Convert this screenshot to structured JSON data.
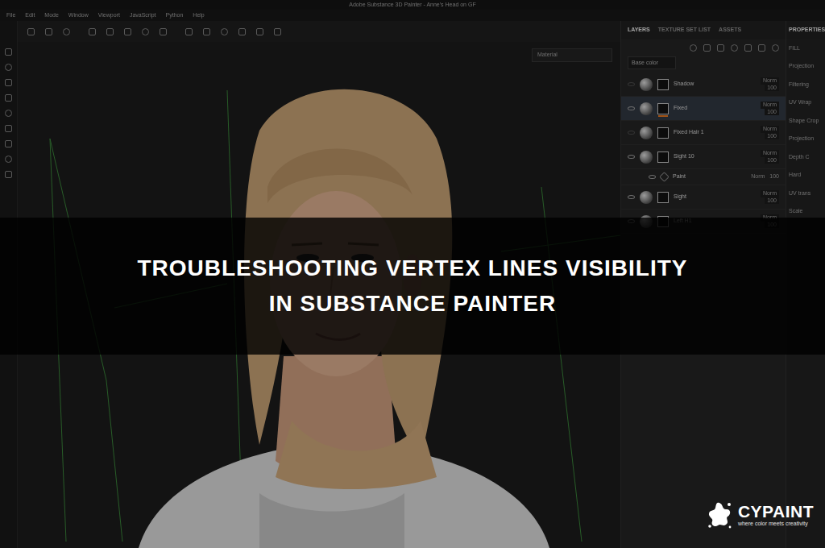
{
  "window": {
    "title": "Adobe Substance 3D Painter - Anne's Head on GF"
  },
  "menu": [
    "File",
    "Edit",
    "Mode",
    "Window",
    "Viewport",
    "JavaScript",
    "Python",
    "Help"
  ],
  "viewport": {
    "mode": "Material"
  },
  "panel_tabs": [
    {
      "label": "LAYERS",
      "selected": true
    },
    {
      "label": "TEXTURE SET LIST",
      "selected": false
    },
    {
      "label": "ASSETS",
      "selected": false
    }
  ],
  "layers": {
    "channel": "Base color",
    "items": [
      {
        "name": "Shadow",
        "blend": "Norm",
        "opacity": "100",
        "visible": false,
        "selected": false,
        "kind": "layer"
      },
      {
        "name": "Fixed",
        "blend": "Norm",
        "opacity": "100",
        "visible": true,
        "selected": true,
        "kind": "layer"
      },
      {
        "name": "Fixed Hair 1",
        "blend": "Norm",
        "opacity": "100",
        "visible": false,
        "selected": false,
        "kind": "layer"
      },
      {
        "name": "Sight 10",
        "blend": "Norm",
        "opacity": "100",
        "visible": true,
        "selected": false,
        "kind": "layer"
      },
      {
        "name": "Paint",
        "blend": "Norm",
        "opacity": "100",
        "visible": true,
        "selected": false,
        "kind": "effect"
      },
      {
        "name": "Sight",
        "blend": "Norm",
        "opacity": "100",
        "visible": true,
        "selected": false,
        "kind": "layer"
      },
      {
        "name": "Left H1",
        "blend": "Norm",
        "opacity": "100",
        "visible": true,
        "selected": false,
        "kind": "layer"
      }
    ]
  },
  "properties": {
    "title": "PROPERTIES",
    "labels": [
      "FILL",
      "Projection",
      "Filtering",
      "UV Wrap",
      "Shape Crop",
      "Projection",
      "Depth C",
      "Hard",
      "UV trans",
      "Scale"
    ]
  },
  "overlay": {
    "lines": [
      "TROUBLESHOOTING VERTEX LINES VISIBILITY",
      "IN SUBSTANCE PAINTER"
    ]
  },
  "logo": {
    "name": "CYPAINT",
    "tagline": "where color meets creativity"
  }
}
